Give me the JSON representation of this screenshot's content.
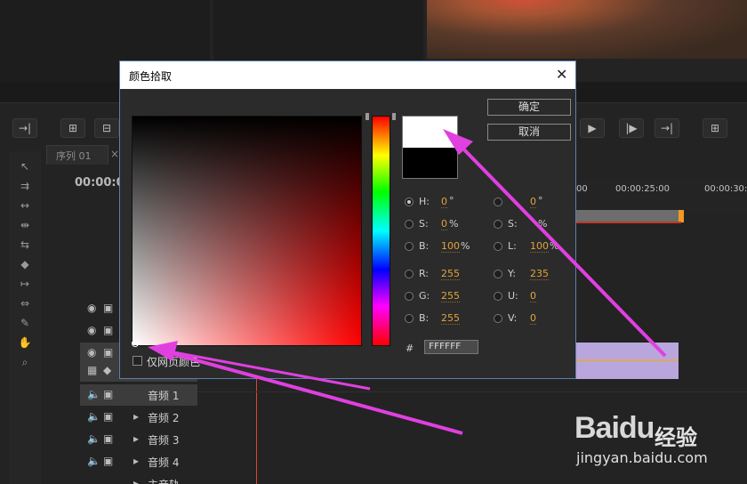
{
  "timeline": {
    "sequence_tab": "序列 01",
    "timecode": "00:00:0",
    "ruler_labels": [
      "00",
      "00:00:25:00",
      "00:00:30:"
    ],
    "tracks": [
      {
        "kind": "video",
        "label": ""
      },
      {
        "kind": "video",
        "label": ""
      },
      {
        "kind": "video",
        "label": ""
      },
      {
        "kind": "audio",
        "label": "音频 1"
      },
      {
        "kind": "audio",
        "label": "音频 2"
      },
      {
        "kind": "audio",
        "label": "音频 3"
      },
      {
        "kind": "audio",
        "label": "音频 4"
      },
      {
        "kind": "audio",
        "label": "主音轨"
      }
    ]
  },
  "dialog": {
    "title": "颜色拾取",
    "ok_label": "确定",
    "cancel_label": "取消",
    "hsb": {
      "h_label": "H:",
      "h_value": "0",
      "h_unit": "°",
      "s_label": "S:",
      "s_value": "0",
      "s_unit": "%",
      "b_label": "B:",
      "b_value": "100",
      "b_unit": "%"
    },
    "hsl": {
      "h_value": "0",
      "h_unit": "°",
      "s_label": "S:",
      "s_unit": "%",
      "l_label": "L:",
      "l_value": "100",
      "l_unit": "%"
    },
    "rgb": {
      "r_label": "R:",
      "r_value": "255",
      "g_label": "G:",
      "g_value": "255",
      "b_label": "B:",
      "b_value": "255"
    },
    "yuv": {
      "y_label": "Y:",
      "y_value": "235",
      "u_label": "U:",
      "u_value": "0",
      "v_label": "V:",
      "v_value": "0"
    },
    "hex_label": "#",
    "hex_value": "FFFFFF",
    "web_colors_label": "仅网页颜色",
    "new_color": "#ffffff",
    "old_color": "#000000"
  },
  "watermark": {
    "logo": "Baidu",
    "text": "经验",
    "url": "jingyan.baidu.com"
  },
  "colors": {
    "annotation_arrow": "#e040e0",
    "value_orange": "#e3a33a",
    "playhead": "#d9472e",
    "clip_purple": "#b9a6dc"
  }
}
